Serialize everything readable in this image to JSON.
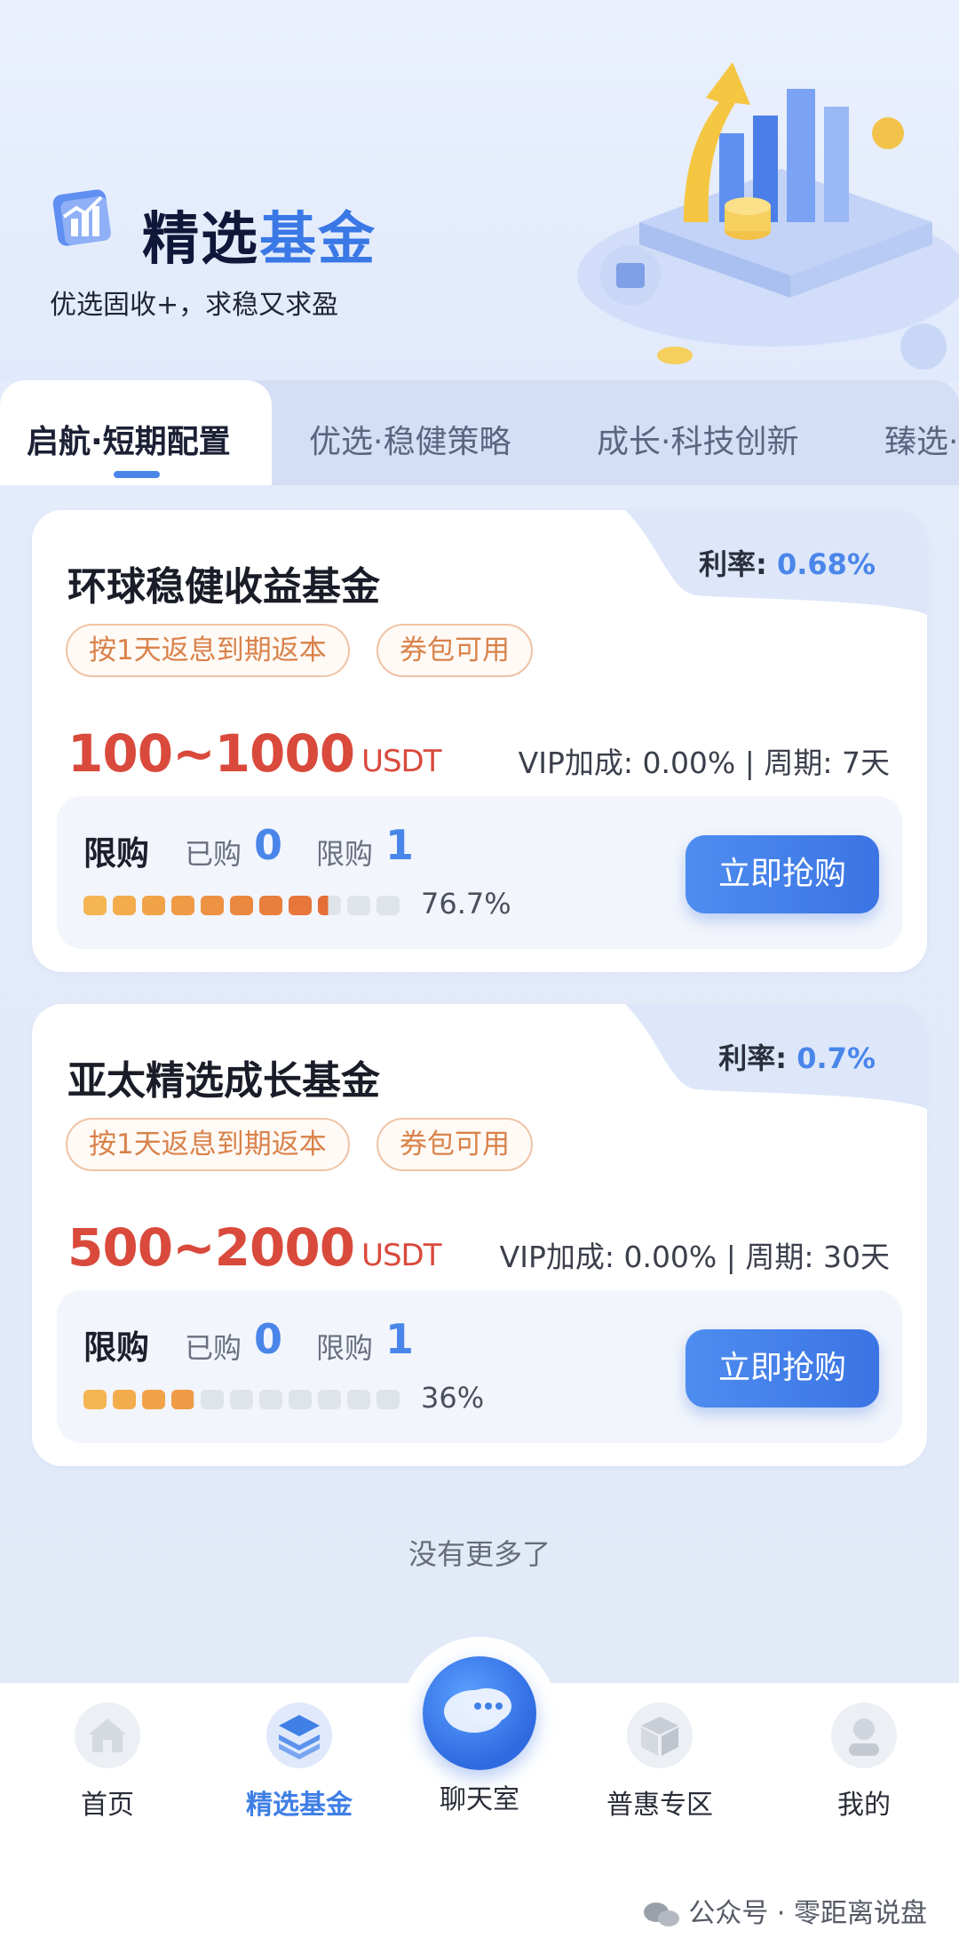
{
  "header": {
    "title_part1": "精选",
    "title_part2": "基金",
    "subtitle": "优选固收+，求稳又求盈"
  },
  "tabs": [
    {
      "label": "启航·短期配置",
      "active": true
    },
    {
      "label": "优选·稳健策略",
      "active": false
    },
    {
      "label": "成长·科技创新",
      "active": false
    },
    {
      "label": "臻选·",
      "active": false
    }
  ],
  "funds": [
    {
      "rate_label": "利率:",
      "rate_value": "0.68%",
      "name": "环球稳健收益基金",
      "chips": [
        "按1天返息到期返本",
        "券包可用"
      ],
      "amount": "100~1000",
      "unit": "USDT",
      "vip_period": "VIP加成: 0.00% | 周期: 7天",
      "limit_label": "限购",
      "bought_label": "已购",
      "bought_value": "0",
      "limit_count_label": "限购",
      "limit_count_value": "1",
      "progress_percent": 76.7,
      "progress_text": "76.7%",
      "buy_label": "立即抢购"
    },
    {
      "rate_label": "利率:",
      "rate_value": "0.7%",
      "name": "亚太精选成长基金",
      "chips": [
        "按1天返息到期返本",
        "券包可用"
      ],
      "amount": "500~2000",
      "unit": "USDT",
      "vip_period": "VIP加成: 0.00% | 周期: 30天",
      "limit_label": "限购",
      "bought_label": "已购",
      "bought_value": "0",
      "limit_count_label": "限购",
      "limit_count_value": "1",
      "progress_percent": 36,
      "progress_text": "36%",
      "buy_label": "立即抢购"
    }
  ],
  "footer_note": "没有更多了",
  "nav": {
    "items": [
      {
        "label": "首页",
        "icon": "home-icon",
        "active": false
      },
      {
        "label": "精选基金",
        "icon": "layers-icon",
        "active": true
      },
      {
        "label": "聊天室",
        "icon": "chat-bubbles-icon",
        "active": false
      },
      {
        "label": "普惠专区",
        "icon": "box-icon",
        "active": false
      },
      {
        "label": "我的",
        "icon": "user-icon",
        "active": false
      }
    ]
  },
  "watermark": "公众号 · 零距离说盘",
  "colors": {
    "accent": "#4a86ea",
    "amount_red": "#d94a3c",
    "chip_orange": "#d9824a",
    "progress_filled": "#f0a040",
    "progress_empty": "#dfe3ea"
  }
}
